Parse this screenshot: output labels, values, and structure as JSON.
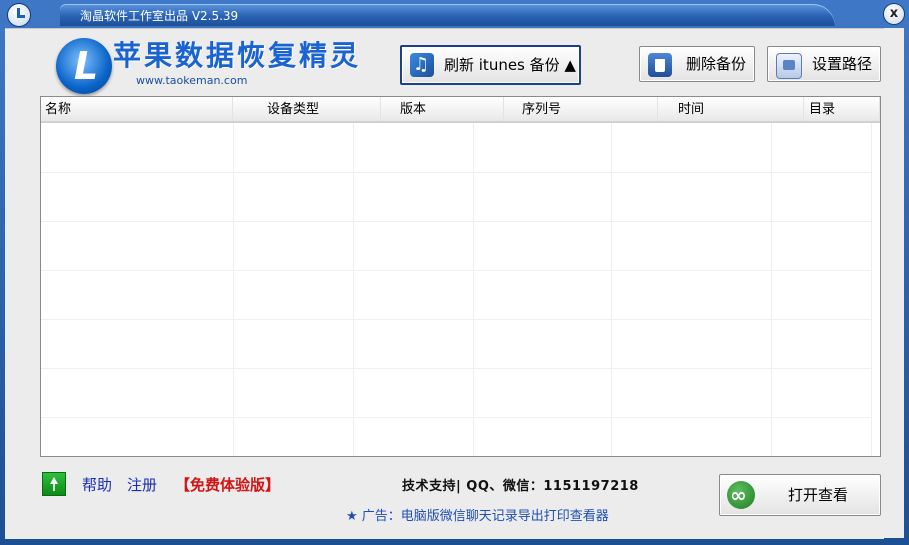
{
  "window": {
    "title": "淘晶软件工作室出品 V2.5.39",
    "close_glyph": "x"
  },
  "logo": {
    "title": "苹果数据恢复精灵",
    "url": "www.taokeman.com",
    "letter": "L"
  },
  "toolbar": {
    "refresh_label": "刷新 itunes 备份 ▲",
    "delete_label": "删除备份",
    "setpath_label": "设置路径"
  },
  "table": {
    "columns": [
      "名称",
      "设备类型",
      "版本",
      "序列号",
      "时间",
      "目录"
    ],
    "rows": []
  },
  "footer": {
    "help": "帮助",
    "register": "注册",
    "trial": "【免费体验版】",
    "support": "技术支持| QQ、微信：1151197218",
    "ad": "★ 广告：电脑版微信聊天记录导出打印查看器",
    "open_label": "打开查看"
  }
}
